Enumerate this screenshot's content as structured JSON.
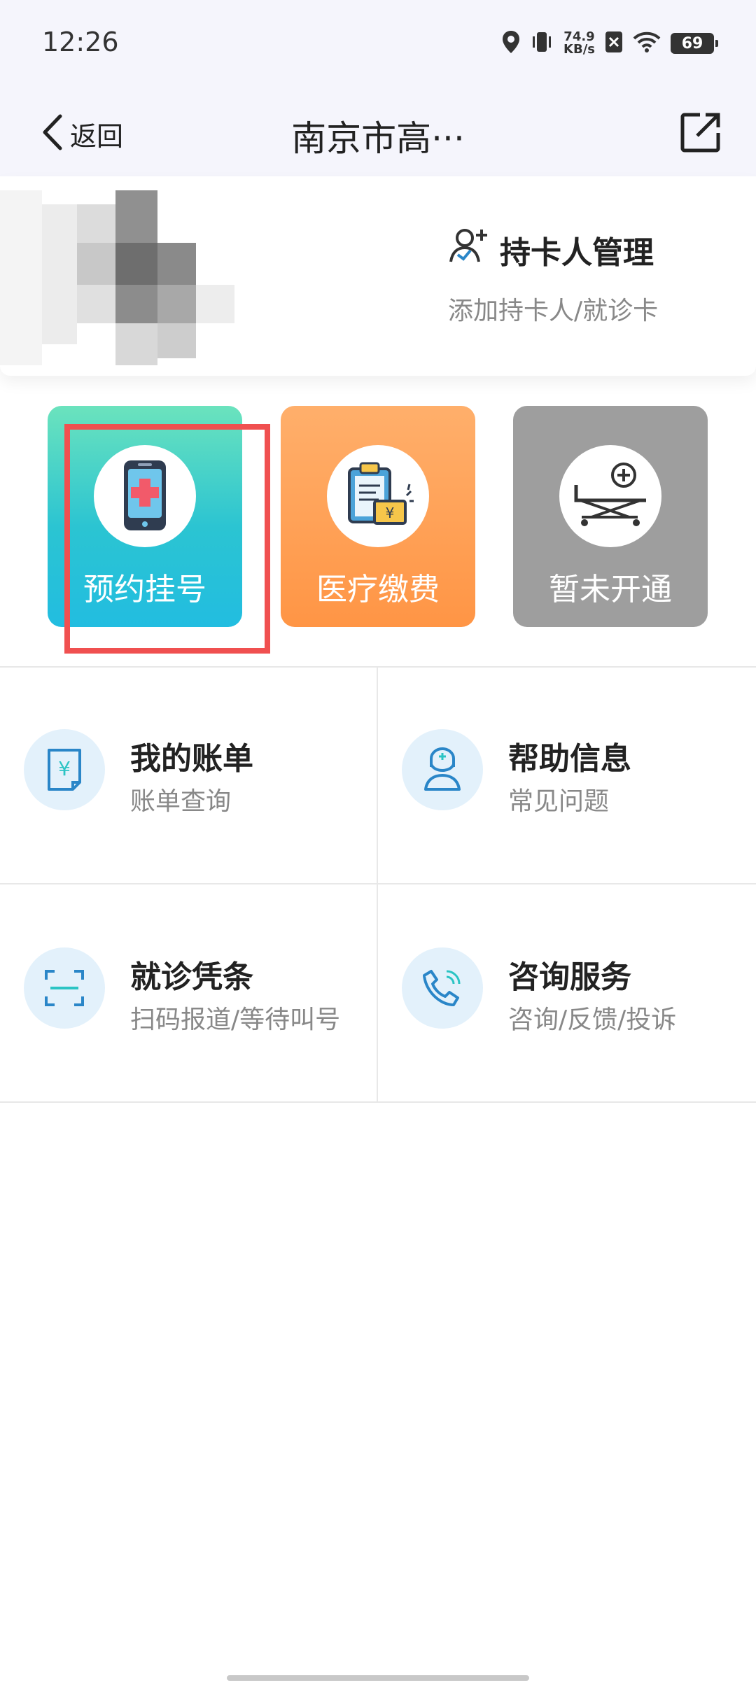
{
  "status_bar": {
    "time": "12:26",
    "net_speed_value": "74.9",
    "net_speed_unit": "KB/s",
    "battery": "69"
  },
  "nav": {
    "back_label": "返回",
    "title": "南京市高···"
  },
  "card_holder": {
    "title": "持卡人管理",
    "subtitle": "添加持卡人/就诊卡"
  },
  "tiles": [
    {
      "label": "预约挂号",
      "icon": "phone-medical-icon",
      "color": "#22bde0"
    },
    {
      "label": "医疗缴费",
      "icon": "clipboard-payment-icon",
      "color": "#ff9545"
    },
    {
      "label": "暂未开通",
      "icon": "hospital-bed-icon",
      "color": "#9e9e9e"
    }
  ],
  "grid": [
    {
      "title": "我的账单",
      "subtitle": "账单查询",
      "icon": "bill-icon"
    },
    {
      "title": "帮助信息",
      "subtitle": "常见问题",
      "icon": "doctor-icon"
    },
    {
      "title": "就诊凭条",
      "subtitle": "扫码报道/等待叫号",
      "icon": "scan-icon"
    },
    {
      "title": "咨询服务",
      "subtitle": "咨询/反馈/投诉",
      "icon": "phone-icon"
    }
  ],
  "colors": {
    "highlight": "#f05050",
    "accent_blue": "#2a86c8",
    "icon_bg": "#e3f1fb"
  }
}
